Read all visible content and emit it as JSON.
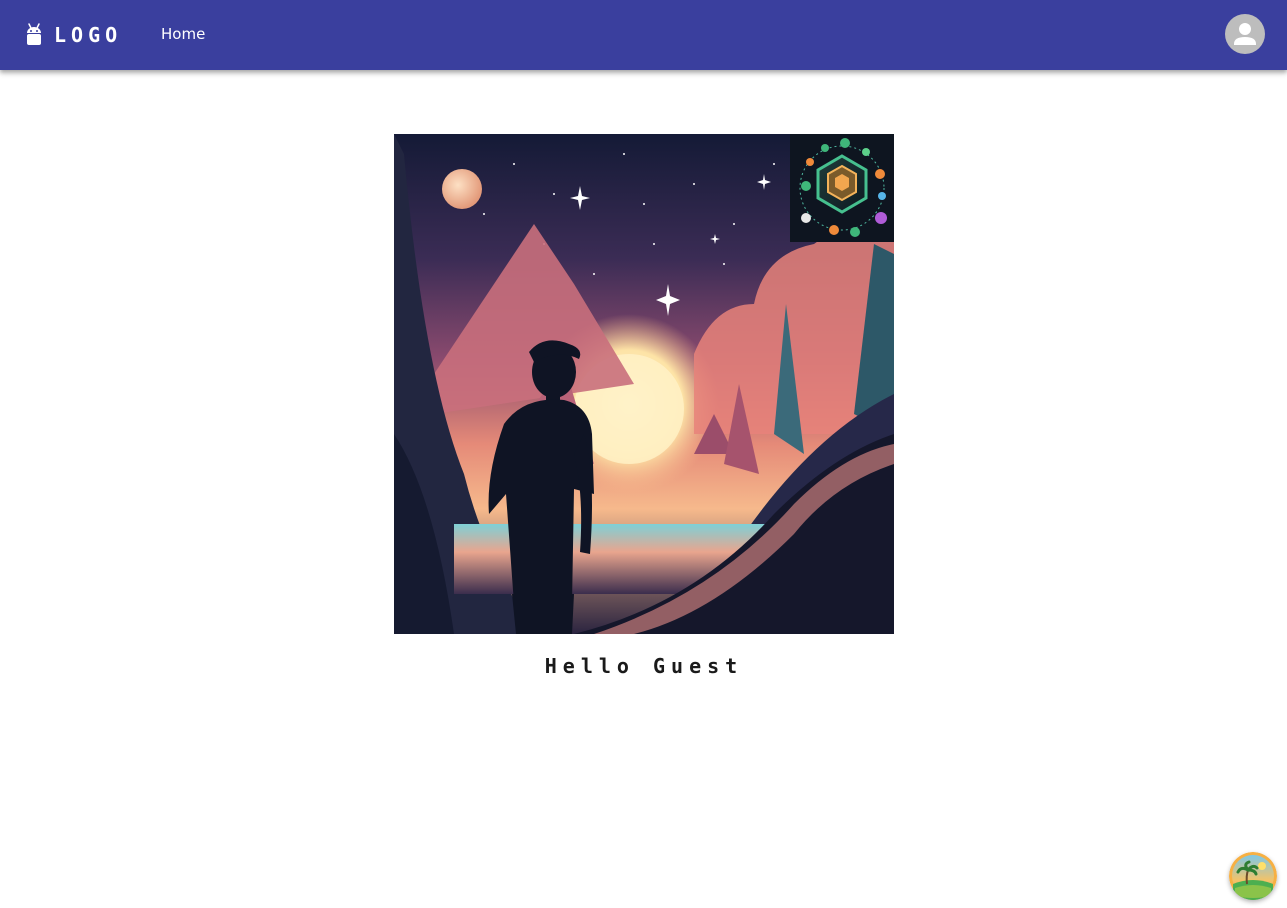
{
  "header": {
    "logo_text": "LOGO",
    "logo_icon": "android-icon",
    "nav": [
      {
        "label": "Home"
      }
    ],
    "avatar_icon": "account-circle-icon"
  },
  "main": {
    "greeting": "Hello Guest",
    "hero_image": "sunset-landscape-with-person",
    "badge_image": "hexagon-network-graphic"
  },
  "fab": {
    "icon": "island-palm-tree-icon"
  },
  "colors": {
    "appbar": "#3a3f9e",
    "avatar_bg": "#bdbdbd",
    "text": "#1a1a1a"
  }
}
